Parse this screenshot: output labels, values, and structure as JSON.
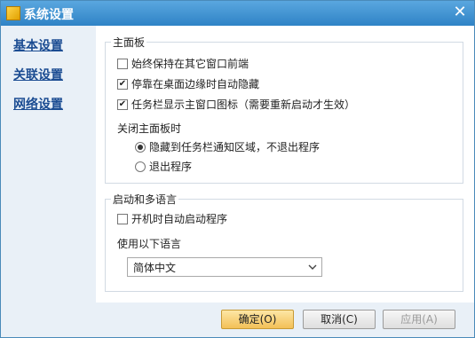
{
  "window": {
    "title": "系统设置"
  },
  "sidebar": {
    "items": [
      {
        "label": "基本设置"
      },
      {
        "label": "关联设置"
      },
      {
        "label": "网络设置"
      }
    ]
  },
  "main_panel": {
    "title": "主面板",
    "options": [
      {
        "label": "始终保持在其它窗口前端",
        "checked": false
      },
      {
        "label": "停靠在桌面边缘时自动隐藏",
        "checked": true
      },
      {
        "label": "任务栏显示主窗口图标（需要重新启动才生效）",
        "checked": true
      }
    ],
    "close_behavior": {
      "label": "关闭主面板时",
      "options": [
        {
          "label": "隐藏到任务栏通知区域，不退出程序",
          "selected": true
        },
        {
          "label": "退出程序",
          "selected": false
        }
      ]
    }
  },
  "startup": {
    "title": "启动和多语言",
    "autostart": {
      "label": "开机时自动启动程序",
      "checked": false
    },
    "language_label": "使用以下语言",
    "language_value": "简体中文"
  },
  "footer": {
    "ok": "确定(O)",
    "cancel": "取消(C)",
    "apply": "应用(A)"
  }
}
